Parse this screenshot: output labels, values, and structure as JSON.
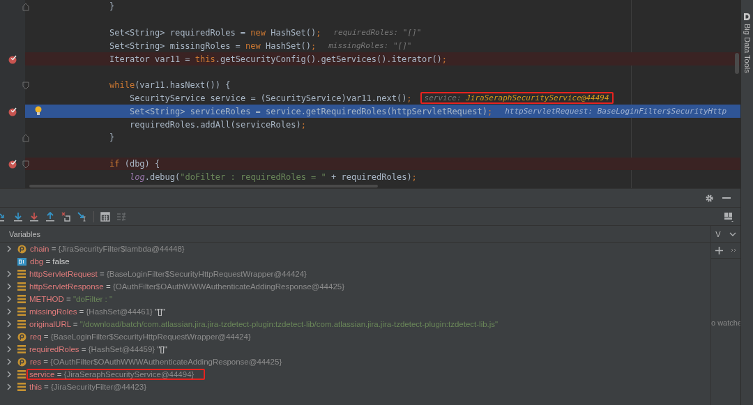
{
  "editor": {
    "lines": [
      {
        "kind": "block-end",
        "breakpoint": false,
        "current": false,
        "tokens": [
          {
            "kind": "plain",
            "text": "}"
          }
        ]
      },
      {
        "breakpoint": false,
        "current": false
      },
      {
        "breakpoint": false,
        "current": false,
        "tokens": [
          {
            "kind": "plain",
            "text": "Set<String> requiredRoles = "
          },
          {
            "kind": "keyword",
            "text": "new"
          },
          {
            "kind": "plain",
            "text": " HashSet()"
          },
          {
            "kind": "keyword",
            "text": ";"
          }
        ],
        "hint": {
          "label": "requiredRoles:",
          "value": "\"[]\"",
          "changed": false,
          "highlighted": false
        }
      },
      {
        "breakpoint": false,
        "current": false,
        "tokens": [
          {
            "kind": "plain",
            "text": "Set<String> missingRoles = "
          },
          {
            "kind": "keyword",
            "text": "new"
          },
          {
            "kind": "plain",
            "text": " HashSet()"
          },
          {
            "kind": "keyword",
            "text": ";"
          }
        ],
        "hint": {
          "label": "missingRoles:",
          "value": "\"[]\"",
          "changed": false,
          "highlighted": false
        }
      },
      {
        "breakpoint": true,
        "current": false,
        "tokens": [
          {
            "kind": "plain",
            "text": "Iterator var11 = "
          },
          {
            "kind": "keyword",
            "text": "this"
          },
          {
            "kind": "plain",
            "text": ".getSecurityConfig().getServices().iterator()"
          },
          {
            "kind": "keyword",
            "text": ";"
          }
        ]
      },
      {
        "breakpoint": false,
        "current": false
      },
      {
        "kind": "block-start",
        "breakpoint": false,
        "current": false,
        "tokens": [
          {
            "kind": "keyword",
            "text": "while"
          },
          {
            "kind": "plain",
            "text": "(var11.hasNext()) {"
          }
        ],
        "children": [
          {
            "breakpoint": false,
            "current": false,
            "tokens": [
              {
                "kind": "plain",
                "text": "SecurityService service = (SecurityService)var11.next()"
              },
              {
                "kind": "keyword",
                "text": ";"
              }
            ],
            "hint": {
              "label": "service:",
              "value": "JiraSeraphSecurityService@44494",
              "changed": true,
              "highlighted": true
            }
          },
          {
            "breakpoint": true,
            "current": true,
            "tokens": [
              {
                "kind": "plain",
                "text": "Set<String> serviceRoles = service.getRequiredRoles(httpServletRequest)"
              },
              {
                "kind": "keyword",
                "text": ";"
              }
            ],
            "hint": {
              "label": "httpServletRequest:",
              "value": "BaseLoginFilter$SecurityHttp",
              "changed": false,
              "highlighted": false
            }
          },
          {
            "breakpoint": false,
            "current": false,
            "tokens": [
              {
                "kind": "plain",
                "text": "requiredRoles.addAll(serviceRoles)"
              },
              {
                "kind": "keyword",
                "text": ";"
              }
            ]
          }
        ]
      },
      {
        "kind": "block-end",
        "breakpoint": false,
        "current": false,
        "tokens": [
          {
            "kind": "plain",
            "text": "}"
          }
        ]
      },
      {
        "breakpoint": false,
        "current": false
      },
      {
        "kind": "block-start",
        "breakpoint": true,
        "current": false,
        "tokens": [
          {
            "kind": "keyword",
            "text": "if"
          },
          {
            "kind": "plain",
            "text": " (dbg) {"
          }
        ],
        "children": [
          {
            "breakpoint": false,
            "current": false,
            "tokens": [
              {
                "kind": "static",
                "text": "log"
              },
              {
                "kind": "plain",
                "text": ".debug("
              },
              {
                "kind": "string",
                "text": "\"doFilter : requiredRoles = \""
              },
              {
                "kind": "plain",
                "text": " + requiredRoles)"
              },
              {
                "kind": "keyword",
                "text": ";"
              }
            ]
          }
        ]
      }
    ]
  },
  "side_strip": {
    "label": "Big Data Tools"
  },
  "debugger": {
    "toolbar": [
      {
        "kind": "step-over",
        "disabled": false
      },
      {
        "kind": "step-into",
        "disabled": false
      },
      {
        "kind": "force-step-into",
        "disabled": false
      },
      {
        "kind": "step-out",
        "disabled": false
      },
      {
        "kind": "drop-frame",
        "disabled": false
      },
      {
        "kind": "run-to-cursor",
        "disabled": false
      },
      {
        "kind": "evaluate",
        "disabled": false
      },
      {
        "kind": "trace",
        "disabled": true
      }
    ],
    "variables_title": "Variables",
    "variables": [
      {
        "kind": "param",
        "expandable": true,
        "name": "chain",
        "operator": "=",
        "value": {
          "kind": "object",
          "text": "{JiraSecurityFilter$lambda@44448}"
        },
        "highlighted": false
      },
      {
        "kind": "primitive",
        "expandable": false,
        "name": "dbg",
        "operator": "=",
        "value": {
          "kind": "primitive",
          "text": "false"
        },
        "highlighted": false
      },
      {
        "kind": "field",
        "expandable": true,
        "name": "httpServletRequest",
        "operator": "=",
        "value": {
          "kind": "object",
          "text": "{BaseLoginFilter$SecurityHttpRequestWrapper@44424}"
        },
        "highlighted": false
      },
      {
        "kind": "field",
        "expandable": true,
        "name": "httpServletResponse",
        "operator": "=",
        "value": {
          "kind": "object",
          "text": "{OAuthFilter$OAuthWWWAuthenticateAddingResponse@44425}"
        },
        "highlighted": false
      },
      {
        "kind": "field",
        "expandable": true,
        "name": "METHOD",
        "operator": "=",
        "value": {
          "kind": "string",
          "text": "\"doFilter : \""
        },
        "highlighted": false
      },
      {
        "kind": "field",
        "expandable": true,
        "name": "missingRoles",
        "operator": "=",
        "value": {
          "kind": "object",
          "text": "{HashSet@44461}"
        },
        "suffix": "\"[]\"",
        "highlighted": false
      },
      {
        "kind": "field",
        "expandable": true,
        "name": "originalURL",
        "operator": "=",
        "value": {
          "kind": "string",
          "text": "\"/download/batch/com.atlassian.jira.jira-tzdetect-plugin:tzdetect-lib/com.atlassian.jira.jira-tzdetect-plugin:tzdetect-lib.js\""
        },
        "highlighted": false
      },
      {
        "kind": "param",
        "expandable": true,
        "name": "req",
        "operator": "=",
        "value": {
          "kind": "object",
          "text": "{BaseLoginFilter$SecurityHttpRequestWrapper@44424}"
        },
        "highlighted": false
      },
      {
        "kind": "field",
        "expandable": true,
        "name": "requiredRoles",
        "operator": "=",
        "value": {
          "kind": "object",
          "text": "{HashSet@44459}"
        },
        "suffix": "\"[]\"",
        "highlighted": false
      },
      {
        "kind": "param",
        "expandable": true,
        "name": "res",
        "operator": "=",
        "value": {
          "kind": "object",
          "text": "{OAuthFilter$OAuthWWWAuthenticateAddingResponse@44425}"
        },
        "highlighted": false
      },
      {
        "kind": "field",
        "expandable": true,
        "name": "service",
        "operator": "=",
        "value": {
          "kind": "object",
          "text": "{JiraSeraphSecurityService@44494}"
        },
        "highlighted": true
      },
      {
        "kind": "field",
        "expandable": true,
        "name": "this",
        "operator": "=",
        "value": {
          "kind": "object",
          "text": "{JiraSecurityFilter@44423}"
        },
        "highlighted": false
      }
    ],
    "watches": {
      "tab": "V",
      "empty_text": "o watche"
    }
  }
}
